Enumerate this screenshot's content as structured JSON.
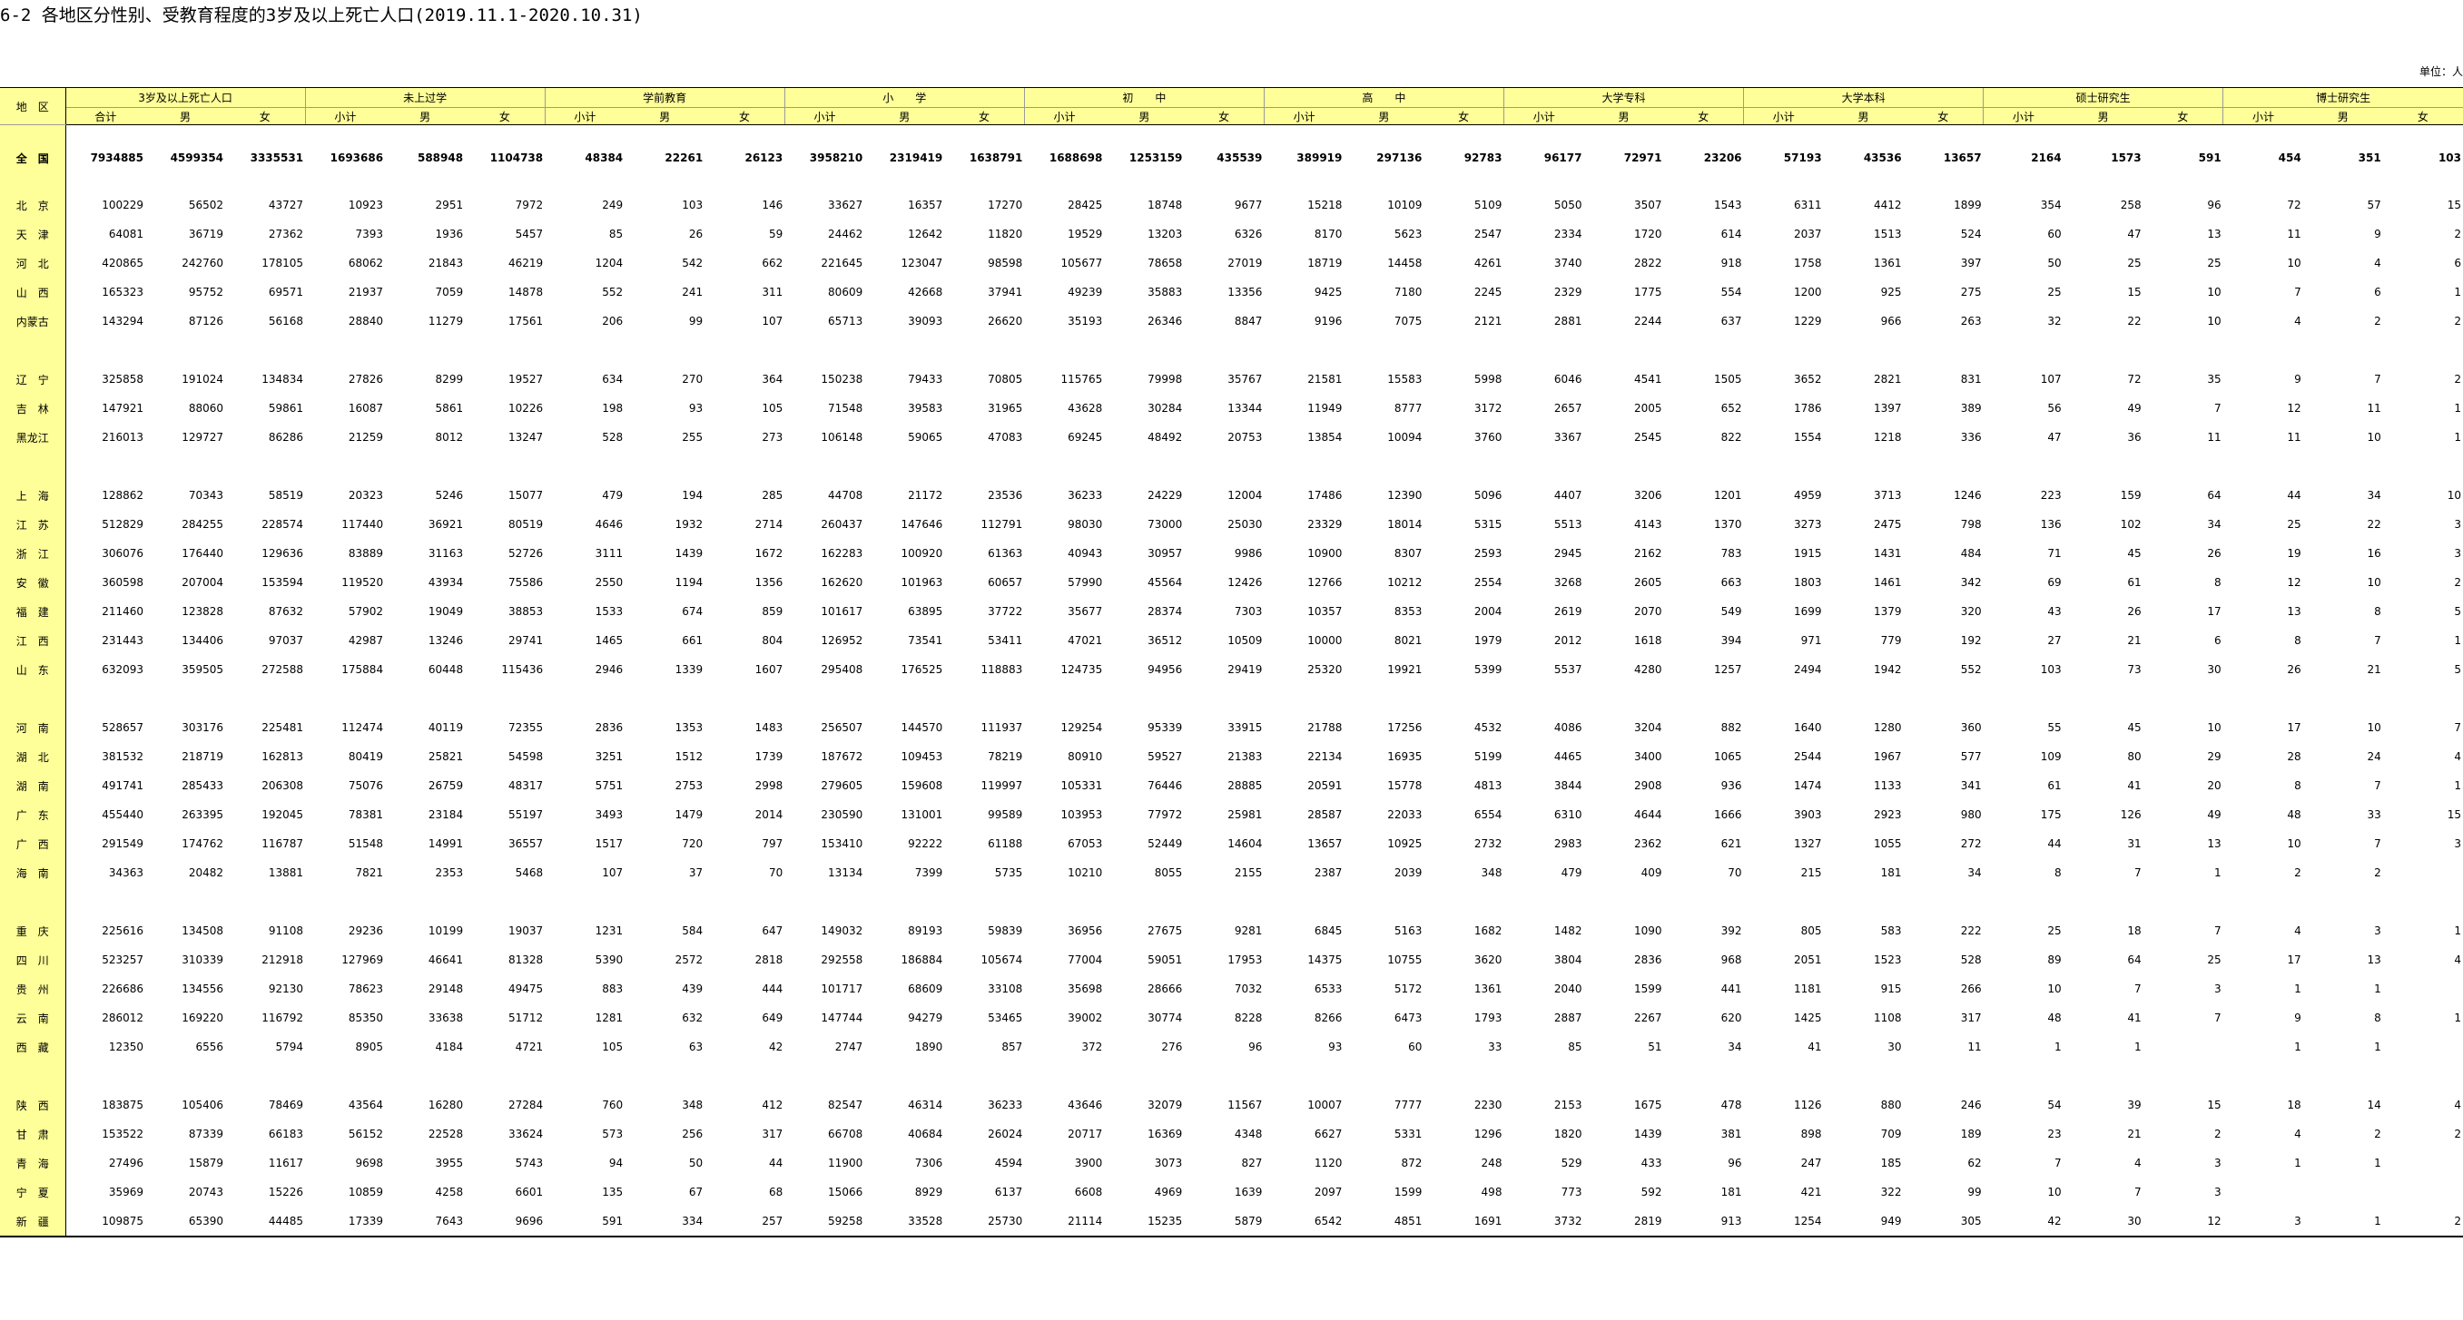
{
  "title": "6-2  各地区分性别、受教育程度的3岁及以上死亡人口(2019.11.1-2020.10.31)",
  "unit": "单位：人",
  "region_header": "地　区",
  "groups": [
    {
      "label": "3岁及以上死亡人口",
      "subs": [
        "合计",
        "男",
        "女"
      ]
    },
    {
      "label": "未上过学",
      "subs": [
        "小计",
        "男",
        "女"
      ]
    },
    {
      "label": "学前教育",
      "subs": [
        "小计",
        "男",
        "女"
      ]
    },
    {
      "label": "小　　学",
      "subs": [
        "小计",
        "男",
        "女"
      ]
    },
    {
      "label": "初　　中",
      "subs": [
        "小计",
        "男",
        "女"
      ]
    },
    {
      "label": "高　　中",
      "subs": [
        "小计",
        "男",
        "女"
      ]
    },
    {
      "label": "大学专科",
      "subs": [
        "小计",
        "男",
        "女"
      ]
    },
    {
      "label": "大学本科",
      "subs": [
        "小计",
        "男",
        "女"
      ]
    },
    {
      "label": "硕士研究生",
      "subs": [
        "小计",
        "男",
        "女"
      ]
    },
    {
      "label": "博士研究生",
      "subs": [
        "小计",
        "男",
        "女"
      ]
    }
  ],
  "rows": [
    {
      "region": "全　国",
      "total": true,
      "values": [
        "7934885",
        "4599354",
        "3335531",
        "1693686",
        "588948",
        "1104738",
        "48384",
        "22261",
        "26123",
        "3958210",
        "2319419",
        "1638791",
        "1688698",
        "1253159",
        "435539",
        "389919",
        "297136",
        "92783",
        "96177",
        "72971",
        "23206",
        "57193",
        "43536",
        "13657",
        "2164",
        "1573",
        "591",
        "454",
        "351",
        "103"
      ]
    },
    {
      "region": "北　京",
      "values": [
        "100229",
        "56502",
        "43727",
        "10923",
        "2951",
        "7972",
        "249",
        "103",
        "146",
        "33627",
        "16357",
        "17270",
        "28425",
        "18748",
        "9677",
        "15218",
        "10109",
        "5109",
        "5050",
        "3507",
        "1543",
        "6311",
        "4412",
        "1899",
        "354",
        "258",
        "96",
        "72",
        "57",
        "15"
      ]
    },
    {
      "region": "天　津",
      "values": [
        "64081",
        "36719",
        "27362",
        "7393",
        "1936",
        "5457",
        "85",
        "26",
        "59",
        "24462",
        "12642",
        "11820",
        "19529",
        "13203",
        "6326",
        "8170",
        "5623",
        "2547",
        "2334",
        "1720",
        "614",
        "2037",
        "1513",
        "524",
        "60",
        "47",
        "13",
        "11",
        "9",
        "2"
      ]
    },
    {
      "region": "河　北",
      "values": [
        "420865",
        "242760",
        "178105",
        "68062",
        "21843",
        "46219",
        "1204",
        "542",
        "662",
        "221645",
        "123047",
        "98598",
        "105677",
        "78658",
        "27019",
        "18719",
        "14458",
        "4261",
        "3740",
        "2822",
        "918",
        "1758",
        "1361",
        "397",
        "50",
        "25",
        "25",
        "10",
        "4",
        "6"
      ]
    },
    {
      "region": "山　西",
      "values": [
        "165323",
        "95752",
        "69571",
        "21937",
        "7059",
        "14878",
        "552",
        "241",
        "311",
        "80609",
        "42668",
        "37941",
        "49239",
        "35883",
        "13356",
        "9425",
        "7180",
        "2245",
        "2329",
        "1775",
        "554",
        "1200",
        "925",
        "275",
        "25",
        "15",
        "10",
        "7",
        "6",
        "1"
      ]
    },
    {
      "region": "内蒙古",
      "values": [
        "143294",
        "87126",
        "56168",
        "28840",
        "11279",
        "17561",
        "206",
        "99",
        "107",
        "65713",
        "39093",
        "26620",
        "35193",
        "26346",
        "8847",
        "9196",
        "7075",
        "2121",
        "2881",
        "2244",
        "637",
        "1229",
        "966",
        "263",
        "32",
        "22",
        "10",
        "4",
        "2",
        "2"
      ]
    },
    {
      "spacer": true
    },
    {
      "region": "辽　宁",
      "values": [
        "325858",
        "191024",
        "134834",
        "27826",
        "8299",
        "19527",
        "634",
        "270",
        "364",
        "150238",
        "79433",
        "70805",
        "115765",
        "79998",
        "35767",
        "21581",
        "15583",
        "5998",
        "6046",
        "4541",
        "1505",
        "3652",
        "2821",
        "831",
        "107",
        "72",
        "35",
        "9",
        "7",
        "2"
      ]
    },
    {
      "region": "吉　林",
      "values": [
        "147921",
        "88060",
        "59861",
        "16087",
        "5861",
        "10226",
        "198",
        "93",
        "105",
        "71548",
        "39583",
        "31965",
        "43628",
        "30284",
        "13344",
        "11949",
        "8777",
        "3172",
        "2657",
        "2005",
        "652",
        "1786",
        "1397",
        "389",
        "56",
        "49",
        "7",
        "12",
        "11",
        "1"
      ]
    },
    {
      "region": "黑龙江",
      "values": [
        "216013",
        "129727",
        "86286",
        "21259",
        "8012",
        "13247",
        "528",
        "255",
        "273",
        "106148",
        "59065",
        "47083",
        "69245",
        "48492",
        "20753",
        "13854",
        "10094",
        "3760",
        "3367",
        "2545",
        "822",
        "1554",
        "1218",
        "336",
        "47",
        "36",
        "11",
        "11",
        "10",
        "1"
      ]
    },
    {
      "spacer": true
    },
    {
      "region": "上　海",
      "values": [
        "128862",
        "70343",
        "58519",
        "20323",
        "5246",
        "15077",
        "479",
        "194",
        "285",
        "44708",
        "21172",
        "23536",
        "36233",
        "24229",
        "12004",
        "17486",
        "12390",
        "5096",
        "4407",
        "3206",
        "1201",
        "4959",
        "3713",
        "1246",
        "223",
        "159",
        "64",
        "44",
        "34",
        "10"
      ]
    },
    {
      "region": "江　苏",
      "values": [
        "512829",
        "284255",
        "228574",
        "117440",
        "36921",
        "80519",
        "4646",
        "1932",
        "2714",
        "260437",
        "147646",
        "112791",
        "98030",
        "73000",
        "25030",
        "23329",
        "18014",
        "5315",
        "5513",
        "4143",
        "1370",
        "3273",
        "2475",
        "798",
        "136",
        "102",
        "34",
        "25",
        "22",
        "3"
      ]
    },
    {
      "region": "浙　江",
      "values": [
        "306076",
        "176440",
        "129636",
        "83889",
        "31163",
        "52726",
        "3111",
        "1439",
        "1672",
        "162283",
        "100920",
        "61363",
        "40943",
        "30957",
        "9986",
        "10900",
        "8307",
        "2593",
        "2945",
        "2162",
        "783",
        "1915",
        "1431",
        "484",
        "71",
        "45",
        "26",
        "19",
        "16",
        "3"
      ]
    },
    {
      "region": "安　徽",
      "values": [
        "360598",
        "207004",
        "153594",
        "119520",
        "43934",
        "75586",
        "2550",
        "1194",
        "1356",
        "162620",
        "101963",
        "60657",
        "57990",
        "45564",
        "12426",
        "12766",
        "10212",
        "2554",
        "3268",
        "2605",
        "663",
        "1803",
        "1461",
        "342",
        "69",
        "61",
        "8",
        "12",
        "10",
        "2"
      ]
    },
    {
      "region": "福　建",
      "values": [
        "211460",
        "123828",
        "87632",
        "57902",
        "19049",
        "38853",
        "1533",
        "674",
        "859",
        "101617",
        "63895",
        "37722",
        "35677",
        "28374",
        "7303",
        "10357",
        "8353",
        "2004",
        "2619",
        "2070",
        "549",
        "1699",
        "1379",
        "320",
        "43",
        "26",
        "17",
        "13",
        "8",
        "5"
      ]
    },
    {
      "region": "江　西",
      "values": [
        "231443",
        "134406",
        "97037",
        "42987",
        "13246",
        "29741",
        "1465",
        "661",
        "804",
        "126952",
        "73541",
        "53411",
        "47021",
        "36512",
        "10509",
        "10000",
        "8021",
        "1979",
        "2012",
        "1618",
        "394",
        "971",
        "779",
        "192",
        "27",
        "21",
        "6",
        "8",
        "7",
        "1"
      ]
    },
    {
      "region": "山　东",
      "values": [
        "632093",
        "359505",
        "272588",
        "175884",
        "60448",
        "115436",
        "2946",
        "1339",
        "1607",
        "295408",
        "176525",
        "118883",
        "124735",
        "94956",
        "29419",
        "25320",
        "19921",
        "5399",
        "5537",
        "4280",
        "1257",
        "2494",
        "1942",
        "552",
        "103",
        "73",
        "30",
        "26",
        "21",
        "5"
      ]
    },
    {
      "spacer": true
    },
    {
      "region": "河　南",
      "values": [
        "528657",
        "303176",
        "225481",
        "112474",
        "40119",
        "72355",
        "2836",
        "1353",
        "1483",
        "256507",
        "144570",
        "111937",
        "129254",
        "95339",
        "33915",
        "21788",
        "17256",
        "4532",
        "4086",
        "3204",
        "882",
        "1640",
        "1280",
        "360",
        "55",
        "45",
        "10",
        "17",
        "10",
        "7"
      ]
    },
    {
      "region": "湖　北",
      "values": [
        "381532",
        "218719",
        "162813",
        "80419",
        "25821",
        "54598",
        "3251",
        "1512",
        "1739",
        "187672",
        "109453",
        "78219",
        "80910",
        "59527",
        "21383",
        "22134",
        "16935",
        "5199",
        "4465",
        "3400",
        "1065",
        "2544",
        "1967",
        "577",
        "109",
        "80",
        "29",
        "28",
        "24",
        "4"
      ]
    },
    {
      "region": "湖　南",
      "values": [
        "491741",
        "285433",
        "206308",
        "75076",
        "26759",
        "48317",
        "5751",
        "2753",
        "2998",
        "279605",
        "159608",
        "119997",
        "105331",
        "76446",
        "28885",
        "20591",
        "15778",
        "4813",
        "3844",
        "2908",
        "936",
        "1474",
        "1133",
        "341",
        "61",
        "41",
        "20",
        "8",
        "7",
        "1"
      ]
    },
    {
      "region": "广　东",
      "values": [
        "455440",
        "263395",
        "192045",
        "78381",
        "23184",
        "55197",
        "3493",
        "1479",
        "2014",
        "230590",
        "131001",
        "99589",
        "103953",
        "77972",
        "25981",
        "28587",
        "22033",
        "6554",
        "6310",
        "4644",
        "1666",
        "3903",
        "2923",
        "980",
        "175",
        "126",
        "49",
        "48",
        "33",
        "15"
      ]
    },
    {
      "region": "广　西",
      "values": [
        "291549",
        "174762",
        "116787",
        "51548",
        "14991",
        "36557",
        "1517",
        "720",
        "797",
        "153410",
        "92222",
        "61188",
        "67053",
        "52449",
        "14604",
        "13657",
        "10925",
        "2732",
        "2983",
        "2362",
        "621",
        "1327",
        "1055",
        "272",
        "44",
        "31",
        "13",
        "10",
        "7",
        "3"
      ]
    },
    {
      "region": "海　南",
      "values": [
        "34363",
        "20482",
        "13881",
        "7821",
        "2353",
        "5468",
        "107",
        "37",
        "70",
        "13134",
        "7399",
        "5735",
        "10210",
        "8055",
        "2155",
        "2387",
        "2039",
        "348",
        "479",
        "409",
        "70",
        "215",
        "181",
        "34",
        "8",
        "7",
        "1",
        "2",
        "2",
        ""
      ]
    },
    {
      "spacer": true
    },
    {
      "region": "重　庆",
      "values": [
        "225616",
        "134508",
        "91108",
        "29236",
        "10199",
        "19037",
        "1231",
        "584",
        "647",
        "149032",
        "89193",
        "59839",
        "36956",
        "27675",
        "9281",
        "6845",
        "5163",
        "1682",
        "1482",
        "1090",
        "392",
        "805",
        "583",
        "222",
        "25",
        "18",
        "7",
        "4",
        "3",
        "1"
      ]
    },
    {
      "region": "四　川",
      "values": [
        "523257",
        "310339",
        "212918",
        "127969",
        "46641",
        "81328",
        "5390",
        "2572",
        "2818",
        "292558",
        "186884",
        "105674",
        "77004",
        "59051",
        "17953",
        "14375",
        "10755",
        "3620",
        "3804",
        "2836",
        "968",
        "2051",
        "1523",
        "528",
        "89",
        "64",
        "25",
        "17",
        "13",
        "4"
      ]
    },
    {
      "region": "贵　州",
      "values": [
        "226686",
        "134556",
        "92130",
        "78623",
        "29148",
        "49475",
        "883",
        "439",
        "444",
        "101717",
        "68609",
        "33108",
        "35698",
        "28666",
        "7032",
        "6533",
        "5172",
        "1361",
        "2040",
        "1599",
        "441",
        "1181",
        "915",
        "266",
        "10",
        "7",
        "3",
        "1",
        "1",
        ""
      ]
    },
    {
      "region": "云　南",
      "values": [
        "286012",
        "169220",
        "116792",
        "85350",
        "33638",
        "51712",
        "1281",
        "632",
        "649",
        "147744",
        "94279",
        "53465",
        "39002",
        "30774",
        "8228",
        "8266",
        "6473",
        "1793",
        "2887",
        "2267",
        "620",
        "1425",
        "1108",
        "317",
        "48",
        "41",
        "7",
        "9",
        "8",
        "1"
      ]
    },
    {
      "region": "西　藏",
      "values": [
        "12350",
        "6556",
        "5794",
        "8905",
        "4184",
        "4721",
        "105",
        "63",
        "42",
        "2747",
        "1890",
        "857",
        "372",
        "276",
        "96",
        "93",
        "60",
        "33",
        "85",
        "51",
        "34",
        "41",
        "30",
        "11",
        "1",
        "1",
        "",
        "1",
        "1",
        ""
      ]
    },
    {
      "spacer": true
    },
    {
      "region": "陕　西",
      "values": [
        "183875",
        "105406",
        "78469",
        "43564",
        "16280",
        "27284",
        "760",
        "348",
        "412",
        "82547",
        "46314",
        "36233",
        "43646",
        "32079",
        "11567",
        "10007",
        "7777",
        "2230",
        "2153",
        "1675",
        "478",
        "1126",
        "880",
        "246",
        "54",
        "39",
        "15",
        "18",
        "14",
        "4"
      ]
    },
    {
      "region": "甘　肃",
      "values": [
        "153522",
        "87339",
        "66183",
        "56152",
        "22528",
        "33624",
        "573",
        "256",
        "317",
        "66708",
        "40684",
        "26024",
        "20717",
        "16369",
        "4348",
        "6627",
        "5331",
        "1296",
        "1820",
        "1439",
        "381",
        "898",
        "709",
        "189",
        "23",
        "21",
        "2",
        "4",
        "2",
        "2"
      ]
    },
    {
      "region": "青　海",
      "values": [
        "27496",
        "15879",
        "11617",
        "9698",
        "3955",
        "5743",
        "94",
        "50",
        "44",
        "11900",
        "7306",
        "4594",
        "3900",
        "3073",
        "827",
        "1120",
        "872",
        "248",
        "529",
        "433",
        "96",
        "247",
        "185",
        "62",
        "7",
        "4",
        "3",
        "1",
        "1",
        ""
      ]
    },
    {
      "region": "宁　夏",
      "values": [
        "35969",
        "20743",
        "15226",
        "10859",
        "4258",
        "6601",
        "135",
        "67",
        "68",
        "15066",
        "8929",
        "6137",
        "6608",
        "4969",
        "1639",
        "2097",
        "1599",
        "498",
        "773",
        "592",
        "181",
        "421",
        "322",
        "99",
        "10",
        "7",
        "3",
        "",
        "",
        ""
      ]
    },
    {
      "region": "新　疆",
      "values": [
        "109875",
        "65390",
        "44485",
        "17339",
        "7643",
        "9696",
        "591",
        "334",
        "257",
        "59258",
        "33528",
        "25730",
        "21114",
        "15235",
        "5879",
        "6542",
        "4851",
        "1691",
        "3732",
        "2819",
        "913",
        "1254",
        "949",
        "305",
        "42",
        "30",
        "12",
        "3",
        "1",
        "2"
      ]
    }
  ]
}
